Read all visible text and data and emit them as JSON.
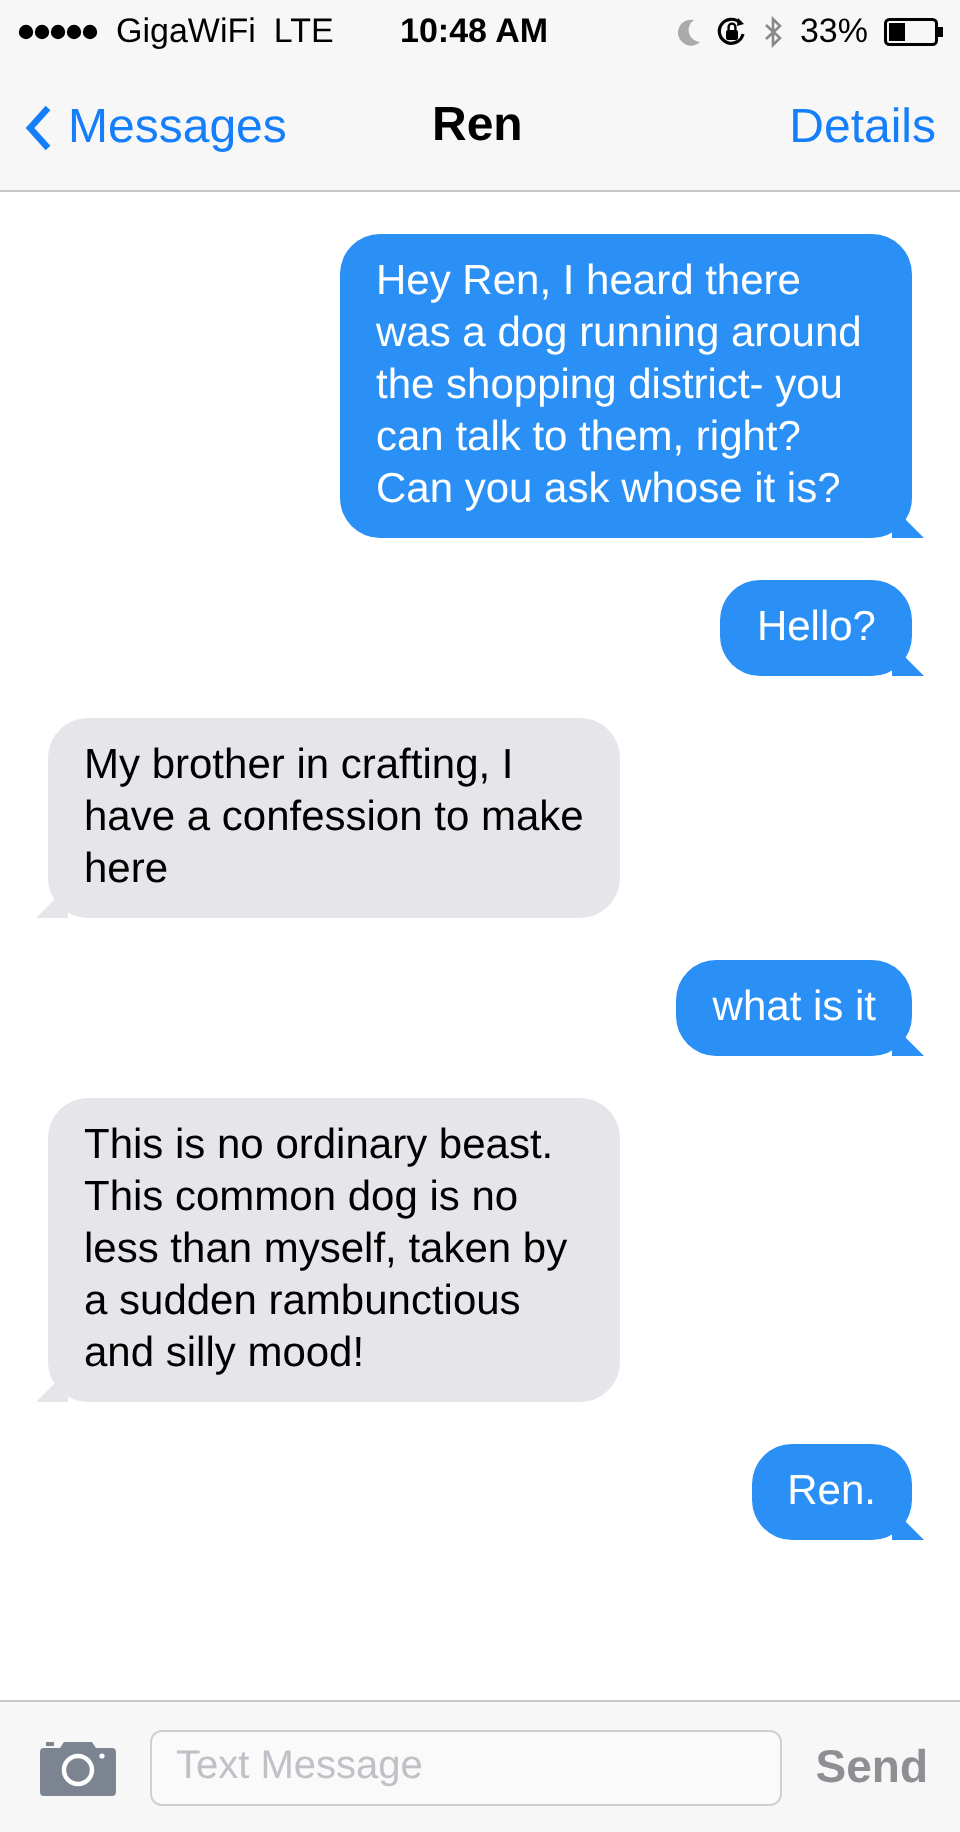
{
  "status_bar": {
    "carrier": "GigaWiFi",
    "network": "LTE",
    "time": "10:48 AM",
    "battery": "33%"
  },
  "nav": {
    "back": "Messages",
    "title": "Ren",
    "action": "Details"
  },
  "messages": [
    {
      "kind": "sent",
      "text": "Hey Ren, I heard there was a dog running around the shopping district- you can talk to them, right? Can you ask whose it is?"
    },
    {
      "kind": "sent",
      "text": "Hello?"
    },
    {
      "kind": "received",
      "text": "My brother in crafting, I have a confession to make here"
    },
    {
      "kind": "sent",
      "text": "what is it"
    },
    {
      "kind": "received",
      "text": "This is no ordinary beast. This common dog is no less than myself, taken by a sudden rambunctious and silly mood!"
    },
    {
      "kind": "sent",
      "text": "Ren."
    }
  ],
  "composer": {
    "placeholder": "Text Message",
    "send": {
      "label": "Send",
      "disabled": true
    }
  }
}
